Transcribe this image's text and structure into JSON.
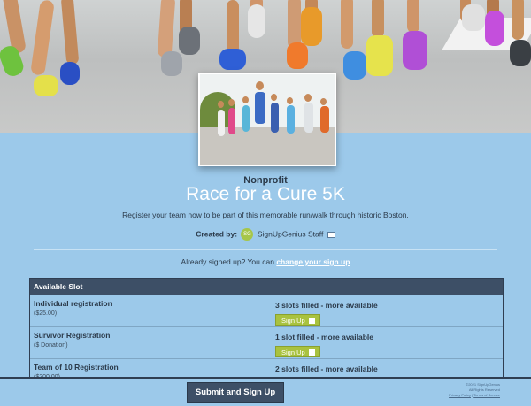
{
  "hero": {
    "image": "marathon-runners-photo",
    "thumbnail": "race-runners-thumbnail"
  },
  "event": {
    "category": "Nonprofit",
    "title": "Race for a Cure 5K",
    "description": "Register your team now to be part of this memorable run/walk through historic Boston.",
    "created_by_label": "Created by:",
    "creator_initials": "SG",
    "creator_name": "SignUpGenius Staff",
    "mail_icon": "mail-icon"
  },
  "already": {
    "text": "Already signed up? You can",
    "link": "change your sign up"
  },
  "slots": {
    "header": "Available Slot",
    "rows": [
      {
        "name": "Individual registration",
        "price": "($25.00)",
        "status": "3 slots filled - more available",
        "button": "Sign Up"
      },
      {
        "name": "Survivor Registration",
        "price": "($ Donation)",
        "status": "1 slot filled - more available",
        "button": "Sign Up"
      },
      {
        "name": "Team of 10 Registration",
        "price": "($200.00)",
        "status": "2 slots filled - more available",
        "button": ""
      }
    ]
  },
  "footer": {
    "submit": "Submit and Sign Up",
    "copyright": "©2021 SignUpGenius",
    "rights": "All Rights Reserved",
    "privacy": "Privacy Policy",
    "terms": "Terms of Service"
  },
  "colors": {
    "background": "#9cc9ea",
    "header_bar": "#3d4f66",
    "signup_button": "#a9c23f",
    "title_text": "#ffffff"
  }
}
